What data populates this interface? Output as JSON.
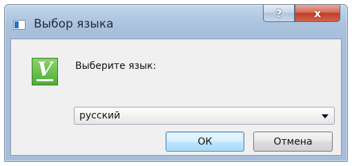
{
  "window": {
    "title": "Выбор языка",
    "help_label": "?",
    "close_label": "x"
  },
  "dialog": {
    "prompt": "Выберите язык:",
    "logo_letter": "V",
    "language_select": {
      "selected": "русский"
    },
    "ok_label": "ОК",
    "cancel_label": "Отмена"
  },
  "colors": {
    "accent": "#3c7fb1",
    "logo_green": "#4fae36",
    "close_red": "#c0402a"
  }
}
